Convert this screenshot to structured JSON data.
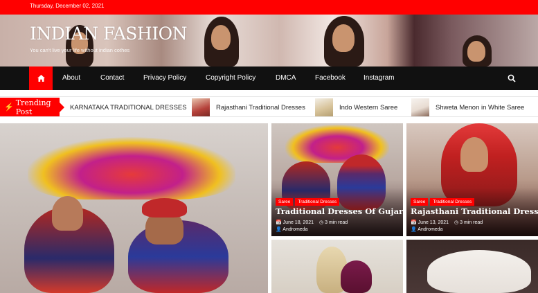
{
  "topbar": {
    "date": "Thursday, December 02, 2021"
  },
  "header": {
    "title": "INDIAN FASHION",
    "tagline": "You can't live your life without indian cothes"
  },
  "nav": {
    "home_icon": "home-icon",
    "items": [
      "About",
      "Contact",
      "Privacy Policy",
      "Copyright Policy",
      "DMCA",
      "Facebook",
      "Instagram"
    ],
    "search_icon": "search-icon"
  },
  "trending": {
    "label": "Trending Post",
    "items": [
      "KARNATAKA TRADITIONAL DRESSES",
      "Rajasthani Traditional Dresses",
      "Indo Western Saree",
      "Shweta Menon in White Saree"
    ]
  },
  "cards": [
    {
      "cats": [
        "Saree",
        "Traditional Dresses"
      ],
      "title": "Traditional Dresses Of Gujarat",
      "date": "June 18, 2021",
      "read": "3 min read",
      "author": "Andromeda"
    },
    {
      "cats": [
        "Saree",
        "Traditional Dresses"
      ],
      "title": "Rajasthani Traditional Dresses",
      "date": "June 13, 2021",
      "read": "3 min read",
      "author": "Andromeda"
    }
  ],
  "colors": {
    "accent": "#ff0000",
    "nav_bg": "#111111"
  }
}
